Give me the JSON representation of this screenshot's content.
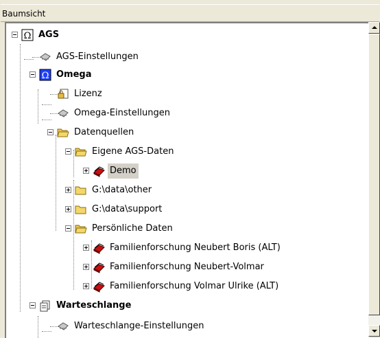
{
  "panel": {
    "title": "Baumsicht"
  },
  "tree": [
    {
      "label": "AGS",
      "bold": true,
      "icon": "omega-icon",
      "toggle": "minus"
    },
    {
      "label": "AGS-Einstellungen",
      "icon": "tools-icon"
    },
    {
      "label": "Omega",
      "bold": true,
      "icon": "omega-blue-icon",
      "toggle": "minus"
    },
    {
      "label": "Lizenz",
      "icon": "license-lock-icon"
    },
    {
      "label": "Omega-Einstellungen",
      "icon": "tools-icon"
    },
    {
      "label": "Datenquellen",
      "icon": "folder-open-icon",
      "toggle": "minus"
    },
    {
      "label": "Eigene AGS-Daten",
      "icon": "folder-open-icon",
      "toggle": "minus"
    },
    {
      "label": "Demo",
      "icon": "database-red-icon",
      "toggle": "plus",
      "selected": true
    },
    {
      "label": "G:\\data\\other",
      "icon": "folder-icon",
      "toggle": "plus"
    },
    {
      "label": "G:\\data\\support",
      "icon": "folder-icon",
      "toggle": "plus"
    },
    {
      "label": "Persönliche Daten",
      "icon": "folder-open-icon",
      "toggle": "minus"
    },
    {
      "label": "Familienforschung Neubert Boris (ALT)",
      "icon": "database-red-icon",
      "toggle": "plus"
    },
    {
      "label": "Familienforschung Neubert-Volmar",
      "icon": "database-red-icon",
      "toggle": "plus"
    },
    {
      "label": "Familienforschung Volmar Ulrike (ALT)",
      "icon": "database-red-icon",
      "toggle": "plus"
    },
    {
      "label": "Warteschlange",
      "bold": true,
      "icon": "queue-icon",
      "toggle": "minus"
    },
    {
      "label": "Warteschlange-Einstellungen",
      "icon": "tools-icon"
    }
  ],
  "colors": {
    "selection": "#d4d0c8",
    "omega_blue": "#1f3fff",
    "db_red": "#c81010",
    "folder": "#f4d76a"
  }
}
